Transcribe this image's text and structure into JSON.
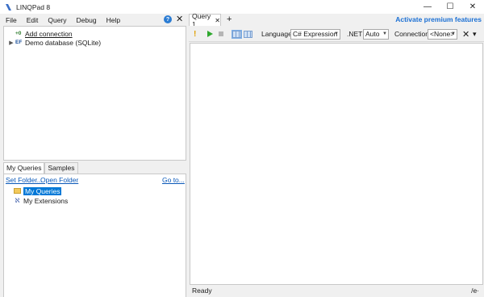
{
  "window": {
    "title": "LINQPad 8",
    "minimize": "—",
    "maximize": "☐",
    "close": "✕"
  },
  "menu": {
    "items": [
      "File",
      "Edit",
      "Query",
      "Debug",
      "Help"
    ],
    "help_symbol": "?",
    "close_symbol": "✕"
  },
  "connections": {
    "add_prefix": "+0",
    "add_label": "Add connection",
    "db_prefix": "EF",
    "db_label": "Demo database (SQLite)"
  },
  "left_tabs": [
    "My Queries",
    "Samples"
  ],
  "queries_panel": {
    "set_folder": "Set Folder...",
    "open_folder": "Open Folder",
    "goto": "Go to...",
    "items": [
      "My Queries",
      "My Extensions"
    ]
  },
  "query_tabs": {
    "tab_label": "Query 1",
    "tab_close": "✕",
    "add_tab": "+",
    "premium": "Activate premium features"
  },
  "toolbar": {
    "language_label": "Language",
    "language_value": "C# Expression",
    "net_label": ".NET",
    "net_value": "Auto",
    "connection_label": "Connection",
    "connection_value": "<None>",
    "close_symbol": "✕",
    "more_symbol": "▾"
  },
  "status": {
    "text": "Ready",
    "right": "/e·"
  },
  "colors": {
    "accent": "#0078d7",
    "link": "#0a58b8",
    "premium": "#1a6fd4",
    "run": "#2ea82e"
  }
}
